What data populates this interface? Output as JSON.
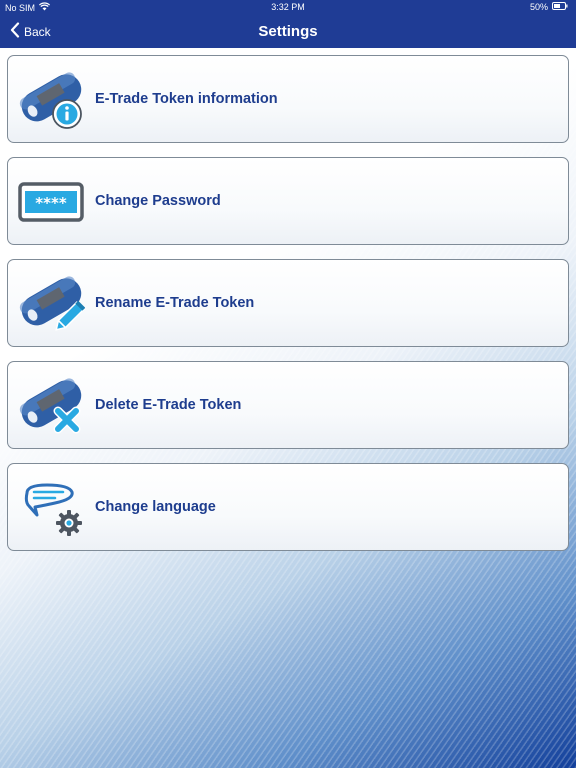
{
  "status_bar": {
    "carrier": "No SIM",
    "time": "3:32 PM",
    "battery": "50%"
  },
  "nav_bar": {
    "back_label": "Back",
    "title": "Settings"
  },
  "settings_items": [
    {
      "label": "E-Trade Token information",
      "icon": "token-info-icon"
    },
    {
      "label": "Change Password",
      "icon": "password-icon"
    },
    {
      "label": "Rename E-Trade Token",
      "icon": "token-rename-icon"
    },
    {
      "label": "Delete E-Trade Token",
      "icon": "token-delete-icon"
    },
    {
      "label": "Change language",
      "icon": "language-settings-icon"
    }
  ],
  "colors": {
    "nav_background": "#1f3c95",
    "label_text": "#1e3d8e",
    "token_blue": "#2f5fa6",
    "accent_cyan": "#29a9e2"
  }
}
